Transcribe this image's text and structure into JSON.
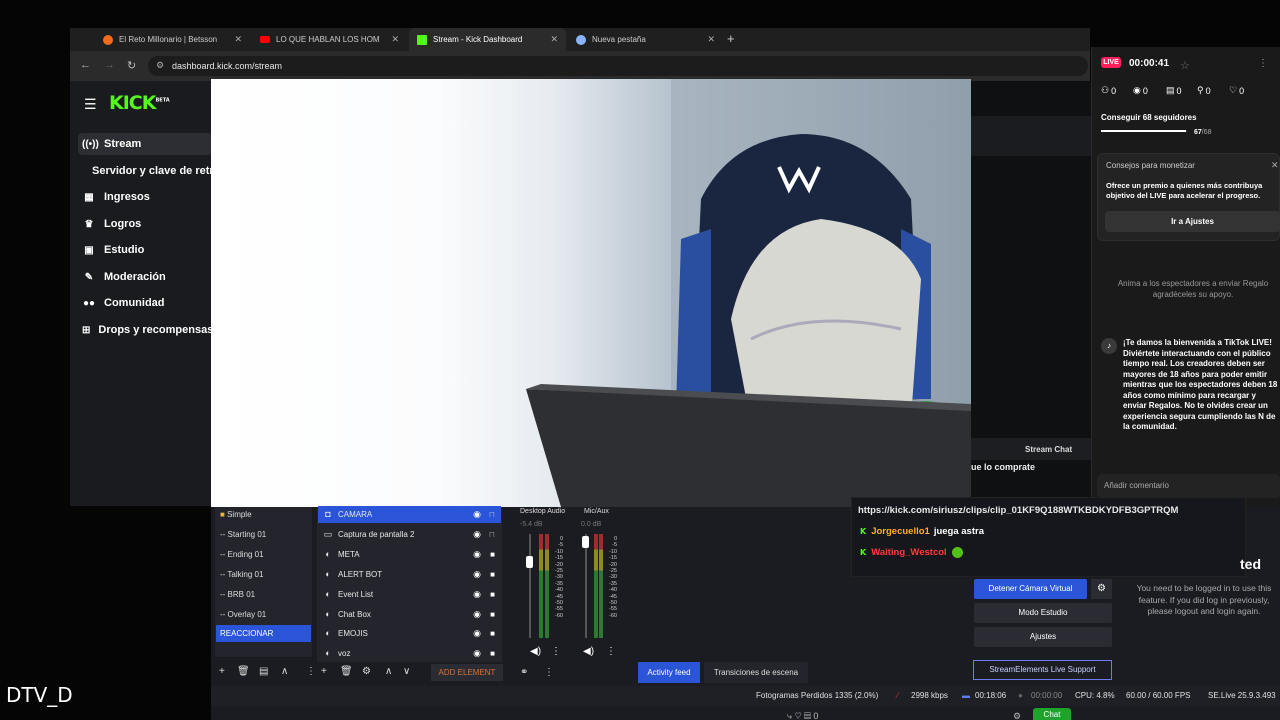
{
  "browser": {
    "tabs": [
      {
        "label": "El Reto Millonario | Betsson",
        "color": "#f26b21"
      },
      {
        "label": "LO QUE HABLAN LOS HOM",
        "color": "#ff0000"
      },
      {
        "label": "Stream - Kick Dashboard",
        "color": "#53fc18"
      },
      {
        "label": "Nueva pestaña",
        "color": "#8ab4f8"
      }
    ],
    "url": "dashboard.kick.com/stream"
  },
  "kick": {
    "logo": "KICK",
    "logo_badge": "BETA",
    "nav": [
      {
        "label": "Stream",
        "icon": "broadcast-icon"
      },
      {
        "label": "Servidor y clave de retr",
        "icon": ""
      },
      {
        "label": "Ingresos",
        "icon": "dollar-icon"
      },
      {
        "label": "Logros",
        "icon": "trophy-icon"
      },
      {
        "label": "Estudio",
        "icon": "studio-icon"
      },
      {
        "label": "Moderación",
        "icon": "wrench-icon"
      },
      {
        "label": "Comunidad",
        "icon": "users-icon"
      },
      {
        "label": "Drops y recompensas",
        "icon": "gift-icon"
      }
    ],
    "stream_chat_tab": "Stream Chat",
    "chat_partial": "ue lo comprate"
  },
  "tiktok": {
    "live_badge": "LIVE",
    "timer": "00:00:41",
    "stats": [
      "0",
      "0",
      "0",
      "0",
      "0"
    ],
    "goal_label": "Conseguir 68 seguidores",
    "goal_current": "67",
    "goal_total": "/68",
    "goal_progress": 0.985,
    "monet_title": "Consejos para monetizar",
    "monet_text": "Ofrece un premio a quienes más contribuya objetivo del LIVE para acelerar el progreso.",
    "monet_button": "Ir a Ajustes",
    "invite_text": "Anima a los espectadores a enviar Regalo agradéceles su apoyo.",
    "welcome_text": "¡Te damos la bienvenida a TikTok LIVE! Diviértete interactuando con el público tiempo real. Los creadores deben ser mayores de 18 años para poder emitir mientras que los espectadores deben 18 años como mínimo para recargar y enviar Regalos. No te olvides crear un experiencia segura cumpliendo las N de la comunidad.",
    "comment_placeholder": "Añadir comentario"
  },
  "obs": {
    "scenes": [
      "Simple",
      "-- Starting 01",
      "-- Ending 01",
      "-- Talking 01",
      "-- BRB 01",
      "-- Overlay 01",
      "REACCIONAR"
    ],
    "sources": [
      {
        "label": "CAMARA",
        "icon": "camera-icon"
      },
      {
        "label": "Captura de pantalla 2",
        "icon": "monitor-icon"
      },
      {
        "label": "META",
        "icon": "globe-icon"
      },
      {
        "label": "ALERT BOT",
        "icon": "globe-icon"
      },
      {
        "label": "Event List",
        "icon": "globe-icon"
      },
      {
        "label": "Chat Box",
        "icon": "globe-icon"
      },
      {
        "label": "EMOJIS",
        "icon": "globe-icon"
      },
      {
        "label": "voz",
        "icon": "globe-icon"
      }
    ],
    "add_element": "ADD ELEMENT",
    "mixer": {
      "desktop_label": "Desktop Audio",
      "desktop_db": "-5.4 dB",
      "mic_label": "Mic/Aux",
      "mic_db": "0.0 dB",
      "scale": [
        "0",
        "-5",
        "-10",
        "-15",
        "-20",
        "-25",
        "-30",
        "-35",
        "-40",
        "-45",
        "-50",
        "-55",
        "-60"
      ]
    },
    "tabs": [
      "Activity feed",
      "Transiciones de escena"
    ],
    "chat": {
      "clip_link": "https://kick.com/siriusz/clips/clip_01KF9Q188WTKBDKYDFB3GPTRQM",
      "lines": [
        {
          "user": "Jorgecuello1",
          "user_color": "#ffb020",
          "text": "juega astra"
        },
        {
          "user": "Waiting_Westcol",
          "user_color": "#ff3b3b",
          "text": ""
        }
      ]
    },
    "controls": {
      "stop_cam": "Detener Cámara Virtual",
      "studio": "Modo Estudio",
      "settings": "Ajustes",
      "se_support": "StreamElements Live Support"
    },
    "login_note": "You need to be logged in to use this feature. If you did log in previously, please logout and login again.",
    "login_partial": "ted",
    "status": {
      "dropped": "Fotogramas Perdidos 1335 (2.0%)",
      "kbps": "2998 kbps",
      "live_time": "00:18:06",
      "rec_time": "00:00:00",
      "cpu": "CPU: 4.8%",
      "fps": "60.00 / 60.00 FPS",
      "version": "SE.Live 25.9.3.493"
    }
  },
  "desktop": {
    "watermark": "DTV_D",
    "taskbar_chat": "Chat",
    "taskbar_counts": "0"
  }
}
